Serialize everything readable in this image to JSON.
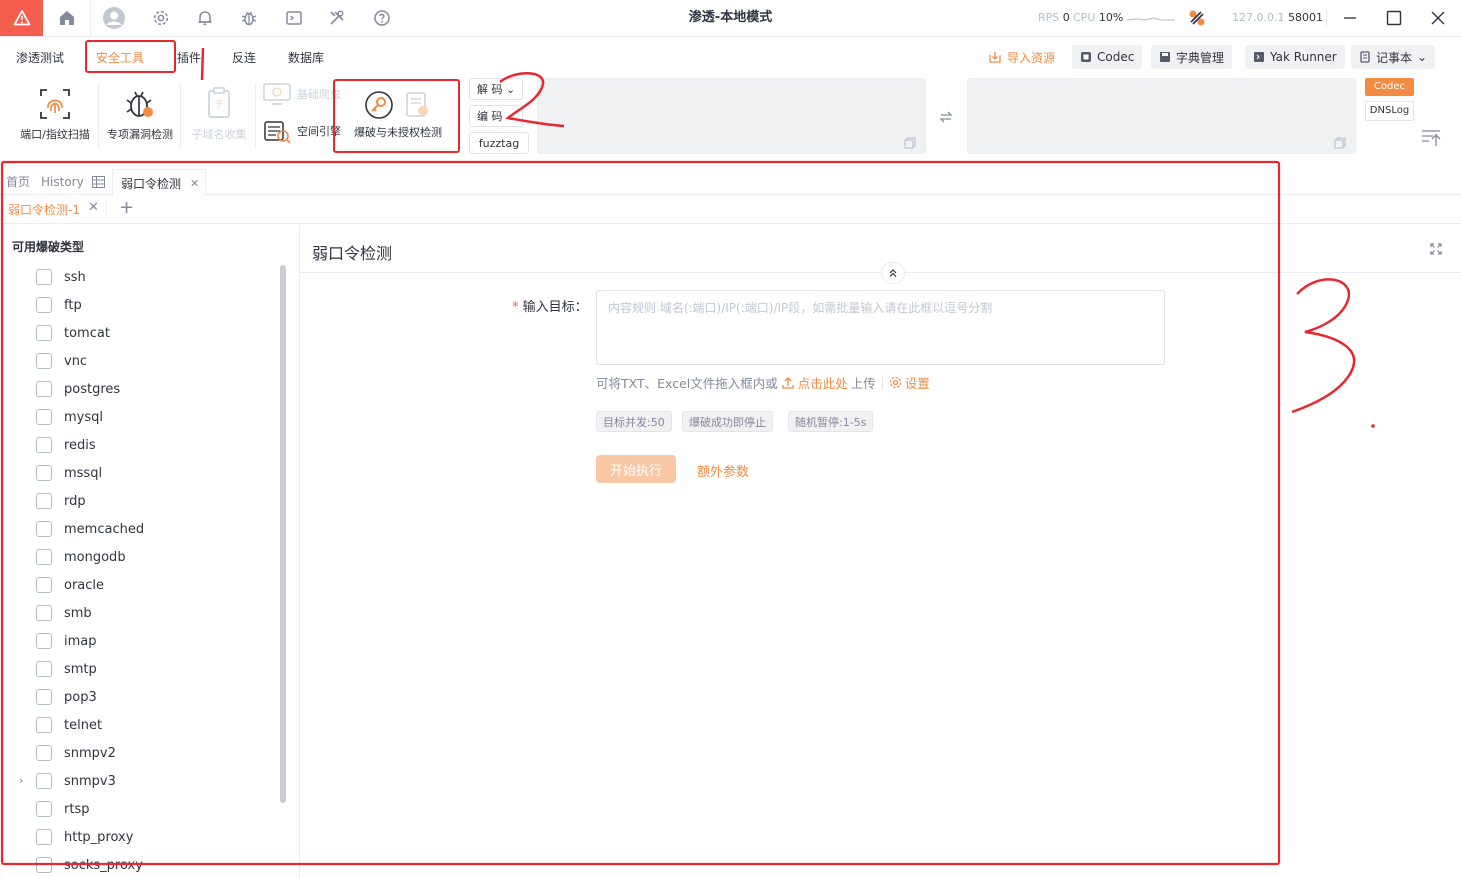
{
  "window": {
    "title": "渗透-本地模式",
    "rps_label": "RPS",
    "rps_value": "0",
    "cpu_label": "CPU",
    "cpu_value": "10%",
    "host": "127.0.0.1",
    "port": "58001",
    "accent": "#f28b44",
    "brand": "#f55d4c"
  },
  "titlebar_icons": [
    "home-icon",
    "avatar",
    "gear-icon",
    "bell-icon",
    "bug-icon",
    "terminal-icon",
    "tools-icon",
    "help-icon"
  ],
  "menu": {
    "items": [
      "渗透测试",
      "安全工具",
      "插件",
      "反连",
      "数据库"
    ],
    "active": "安全工具"
  },
  "top_buttons": {
    "import": "导入资源",
    "codec": "Codec",
    "dict": "字典管理",
    "yak_runner": "Yak Runner",
    "notebook": "记事本"
  },
  "toolbar": {
    "port_scan": "端口/指纹扫描",
    "vuln_check": "专项漏洞检测",
    "subdomain": "子域名收集",
    "crawler": "基础爬虫",
    "space_engine": "空间引擎",
    "brute": "爆破与未授权检测",
    "decode": "解 码",
    "encode": "编 码",
    "fuzztag": "fuzztag",
    "codec_tag": "Codec",
    "dnslog_tag": "DNSLog"
  },
  "tabs": {
    "home": "首页",
    "history": "History",
    "active": "弱口令检测",
    "sub_active": "弱口令检测-1"
  },
  "sidebar": {
    "title": "可用爆破类型",
    "services": [
      "ssh",
      "ftp",
      "tomcat",
      "vnc",
      "postgres",
      "mysql",
      "redis",
      "mssql",
      "rdp",
      "memcached",
      "mongodb",
      "oracle",
      "smb",
      "imap",
      "smtp",
      "pop3",
      "telnet",
      "snmpv2",
      "snmpv3",
      "rtsp",
      "http_proxy",
      "socks_proxy"
    ]
  },
  "main": {
    "title": "弱口令检测",
    "target_required": "*",
    "target_label": "输入目标：",
    "target_placeholder": "内容规则 域名(:端口)/IP(:端口)/IP段，如需批量输入请在此框以逗号分割",
    "upload_hint": "可将TXT、Excel文件拖入框内或",
    "upload_link": "点击此处",
    "upload_suffix": "上传",
    "settings_link": "设置",
    "tags": [
      "目标并发:50",
      "爆破成功即停止",
      "随机暂停:1-5s"
    ],
    "start_button": "开始执行",
    "extra_button": "额外参数"
  },
  "annotations": [
    "2",
    "3"
  ]
}
